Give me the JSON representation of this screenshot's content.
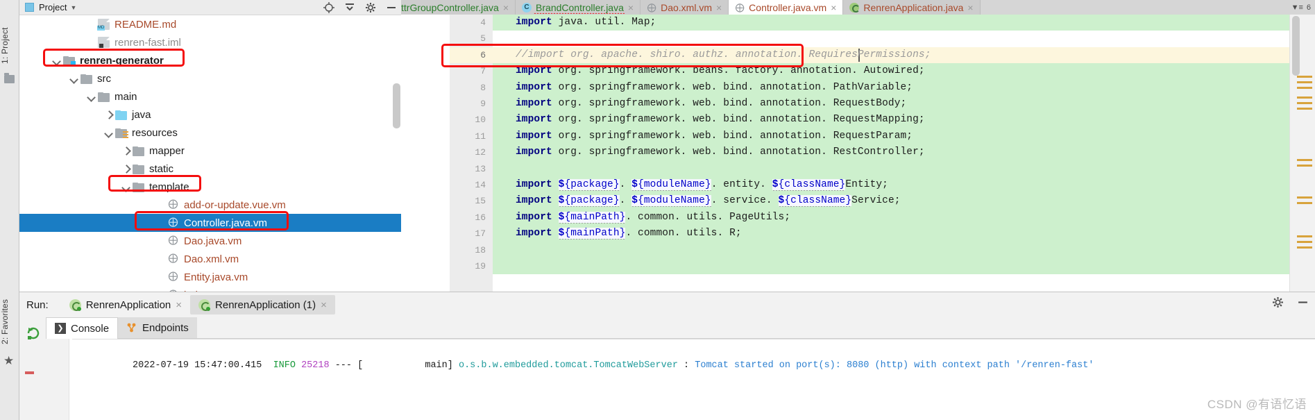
{
  "left_strip": {
    "project_tab": "1: Project",
    "favorites_tab": "2: Favorites",
    "folder_icon": "folder-icon",
    "star_icon": "star-icon"
  },
  "project_panel": {
    "title": "Project",
    "dropdown_icon": "chevron-down-icon",
    "header_icons": [
      "target-icon",
      "collapse-all-icon",
      "gear-icon",
      "hide-icon"
    ],
    "tree": [
      {
        "label": "README.md",
        "indent": 3,
        "arrow": "none",
        "icon": "md-file-icon",
        "color": "orange",
        "bold": false,
        "selected": false
      },
      {
        "label": "renren-fast.iml",
        "indent": 3,
        "arrow": "none",
        "icon": "iml-file-icon",
        "color": "grey",
        "bold": false,
        "selected": false
      },
      {
        "label": "renren-generator",
        "indent": 1,
        "arrow": "open",
        "icon": "module-folder-icon",
        "color": "black",
        "bold": true,
        "selected": false
      },
      {
        "label": "src",
        "indent": 2,
        "arrow": "open",
        "icon": "folder-icon",
        "color": "black",
        "bold": false,
        "selected": false
      },
      {
        "label": "main",
        "indent": 3,
        "arrow": "open",
        "icon": "folder-icon",
        "color": "black",
        "bold": false,
        "selected": false
      },
      {
        "label": "java",
        "indent": 4,
        "arrow": "closed",
        "icon": "sources-folder-icon",
        "color": "black",
        "bold": false,
        "selected": false
      },
      {
        "label": "resources",
        "indent": 4,
        "arrow": "open",
        "icon": "resources-folder-icon",
        "color": "black",
        "bold": false,
        "selected": false
      },
      {
        "label": "mapper",
        "indent": 5,
        "arrow": "closed",
        "icon": "folder-icon",
        "color": "black",
        "bold": false,
        "selected": false
      },
      {
        "label": "static",
        "indent": 5,
        "arrow": "closed",
        "icon": "folder-icon",
        "color": "black",
        "bold": false,
        "selected": false
      },
      {
        "label": "template",
        "indent": 5,
        "arrow": "open",
        "icon": "folder-icon",
        "color": "black",
        "bold": false,
        "selected": false
      },
      {
        "label": "add-or-update.vue.vm",
        "indent": 7,
        "arrow": "none",
        "icon": "velocity-file-icon",
        "color": "orange",
        "bold": false,
        "selected": false
      },
      {
        "label": "Controller.java.vm",
        "indent": 7,
        "arrow": "none",
        "icon": "velocity-file-icon",
        "color": "orange",
        "bold": false,
        "selected": true
      },
      {
        "label": "Dao.java.vm",
        "indent": 7,
        "arrow": "none",
        "icon": "velocity-file-icon",
        "color": "orange",
        "bold": false,
        "selected": false
      },
      {
        "label": "Dao.xml.vm",
        "indent": 7,
        "arrow": "none",
        "icon": "velocity-file-icon",
        "color": "orange",
        "bold": false,
        "selected": false
      },
      {
        "label": "Entity.java.vm",
        "indent": 7,
        "arrow": "none",
        "icon": "velocity-file-icon",
        "color": "orange",
        "bold": false,
        "selected": false
      },
      {
        "label": "index.vue.vm",
        "indent": 7,
        "arrow": "none",
        "icon": "velocity-file-icon",
        "color": "orange",
        "bold": false,
        "selected": false
      }
    ]
  },
  "editor": {
    "tabs": [
      {
        "label": "ttrGroupController.java",
        "icon": "java-class-icon",
        "color": "green",
        "active": false,
        "error": false,
        "clipped": true
      },
      {
        "label": "BrandController.java",
        "icon": "java-class-icon",
        "color": "green",
        "active": false,
        "error": true,
        "clipped": false
      },
      {
        "label": "Dao.xml.vm",
        "icon": "velocity-file-icon",
        "color": "orange",
        "active": false,
        "error": false,
        "clipped": false
      },
      {
        "label": "Controller.java.vm",
        "icon": "velocity-file-icon",
        "color": "orange",
        "active": true,
        "error": false,
        "clipped": false
      },
      {
        "label": "RenrenApplication.java",
        "icon": "spring-boot-icon",
        "color": "orange",
        "active": false,
        "error": false,
        "clipped": false
      }
    ],
    "tab_close_icon": "close-icon",
    "tab_overflow_label": "6",
    "tab_overflow_icon": "chevron-down-list-icon",
    "current_line": 6,
    "lines": [
      {
        "no": 4,
        "type": "code",
        "text": "import java.util.Map;"
      },
      {
        "no": 5,
        "type": "blank",
        "text": ""
      },
      {
        "no": 6,
        "type": "comment",
        "text": "//import org.apache.shiro.authz.annotation.RequiresPermissions;"
      },
      {
        "no": 7,
        "type": "code",
        "text": "import org.springframework.beans.factory.annotation.Autowired;"
      },
      {
        "no": 8,
        "type": "code",
        "text": "import org.springframework.web.bind.annotation.PathVariable;"
      },
      {
        "no": 9,
        "type": "code",
        "text": "import org.springframework.web.bind.annotation.RequestBody;"
      },
      {
        "no": 10,
        "type": "code",
        "text": "import org.springframework.web.bind.annotation.RequestMapping;"
      },
      {
        "no": 11,
        "type": "code",
        "text": "import org.springframework.web.bind.annotation.RequestParam;"
      },
      {
        "no": 12,
        "type": "code",
        "text": "import org.springframework.web.bind.annotation.RestController;"
      },
      {
        "no": 13,
        "type": "blank",
        "text": ""
      },
      {
        "no": 14,
        "type": "tpl",
        "text": "import ${package}.${moduleName}.entity.${className}Entity;"
      },
      {
        "no": 15,
        "type": "tpl",
        "text": "import ${package}.${moduleName}.service.${className}Service;"
      },
      {
        "no": 16,
        "type": "tpl",
        "text": "import ${mainPath}.common.utils.PageUtils;"
      },
      {
        "no": 17,
        "type": "tpl",
        "text": "import ${mainPath}.common.utils.R;"
      },
      {
        "no": 18,
        "type": "blank",
        "text": ""
      },
      {
        "no": 19,
        "type": "blank",
        "text": ""
      }
    ]
  },
  "run_panel": {
    "run_label": "Run:",
    "tabs": [
      {
        "label": "RenrenApplication",
        "active": false,
        "icon": "spring-boot-run-icon"
      },
      {
        "label": "RenrenApplication (1)",
        "active": true,
        "icon": "spring-boot-run-icon"
      }
    ],
    "close_icon": "close-icon",
    "header_icons": [
      "gear-icon",
      "minimize-icon"
    ],
    "rerun_icon": "rerun-icon",
    "stop_icon": "stop-icon",
    "subtabs": [
      {
        "label": "Console",
        "active": true,
        "icon": "console-icon"
      },
      {
        "label": "Endpoints",
        "active": false,
        "icon": "endpoints-icon"
      }
    ],
    "console_log": {
      "timestamp": "2022-07-19 15:47:00.415",
      "level": "INFO",
      "pid": "25218",
      "separator": "---",
      "thread": "[           main]",
      "logger": "o.s.b.w.embedded.tomcat.TomcatWebServer",
      "colon": ":",
      "message": "Tomcat started on port(s): 8080 (http) with context path '/renren-fast'"
    }
  },
  "annotations": {
    "highlight_color": "#f40d0d",
    "boxes": [
      "renren-generator-folder",
      "template-folder",
      "controller-java-vm-file",
      "commented-import-line"
    ]
  },
  "watermark": "CSDN @有语忆语"
}
